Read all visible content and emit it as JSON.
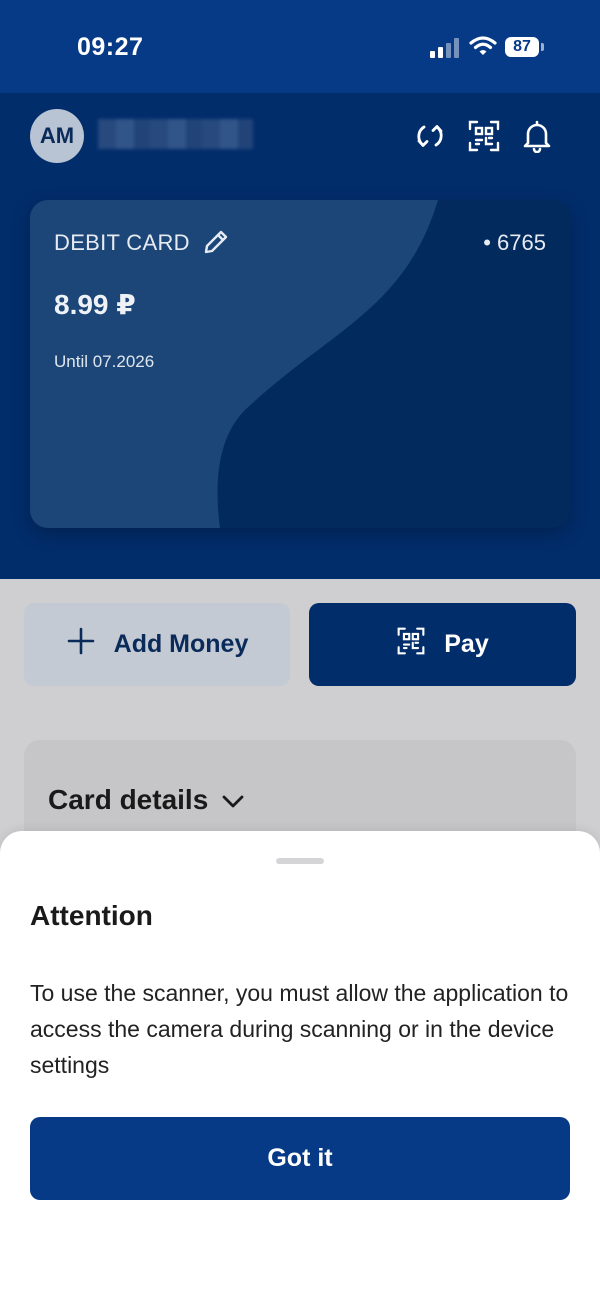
{
  "status_bar": {
    "time": "09:27",
    "battery": "87"
  },
  "header": {
    "avatar_initials": "AM"
  },
  "card": {
    "type": "DEBIT CARD",
    "number": "• 6765",
    "balance": "8.99 ₽",
    "expiry": "Until 07.2026"
  },
  "actions": {
    "add_money": "Add Money",
    "pay": "Pay"
  },
  "details": {
    "title": "Card details"
  },
  "sheet": {
    "title": "Attention",
    "body": "To use the scanner, you must allow the application to access the camera during scanning or in the device settings",
    "button": "Got it"
  },
  "colors": {
    "primary": "#063a86",
    "header_bg": "#022d6b",
    "card_bg": "#022a5c"
  },
  "icons": [
    "signal-icon",
    "wifi-icon",
    "refresh-icon",
    "qr-scan-icon",
    "bell-icon",
    "edit-icon",
    "plus-icon",
    "chevron-down-icon"
  ]
}
